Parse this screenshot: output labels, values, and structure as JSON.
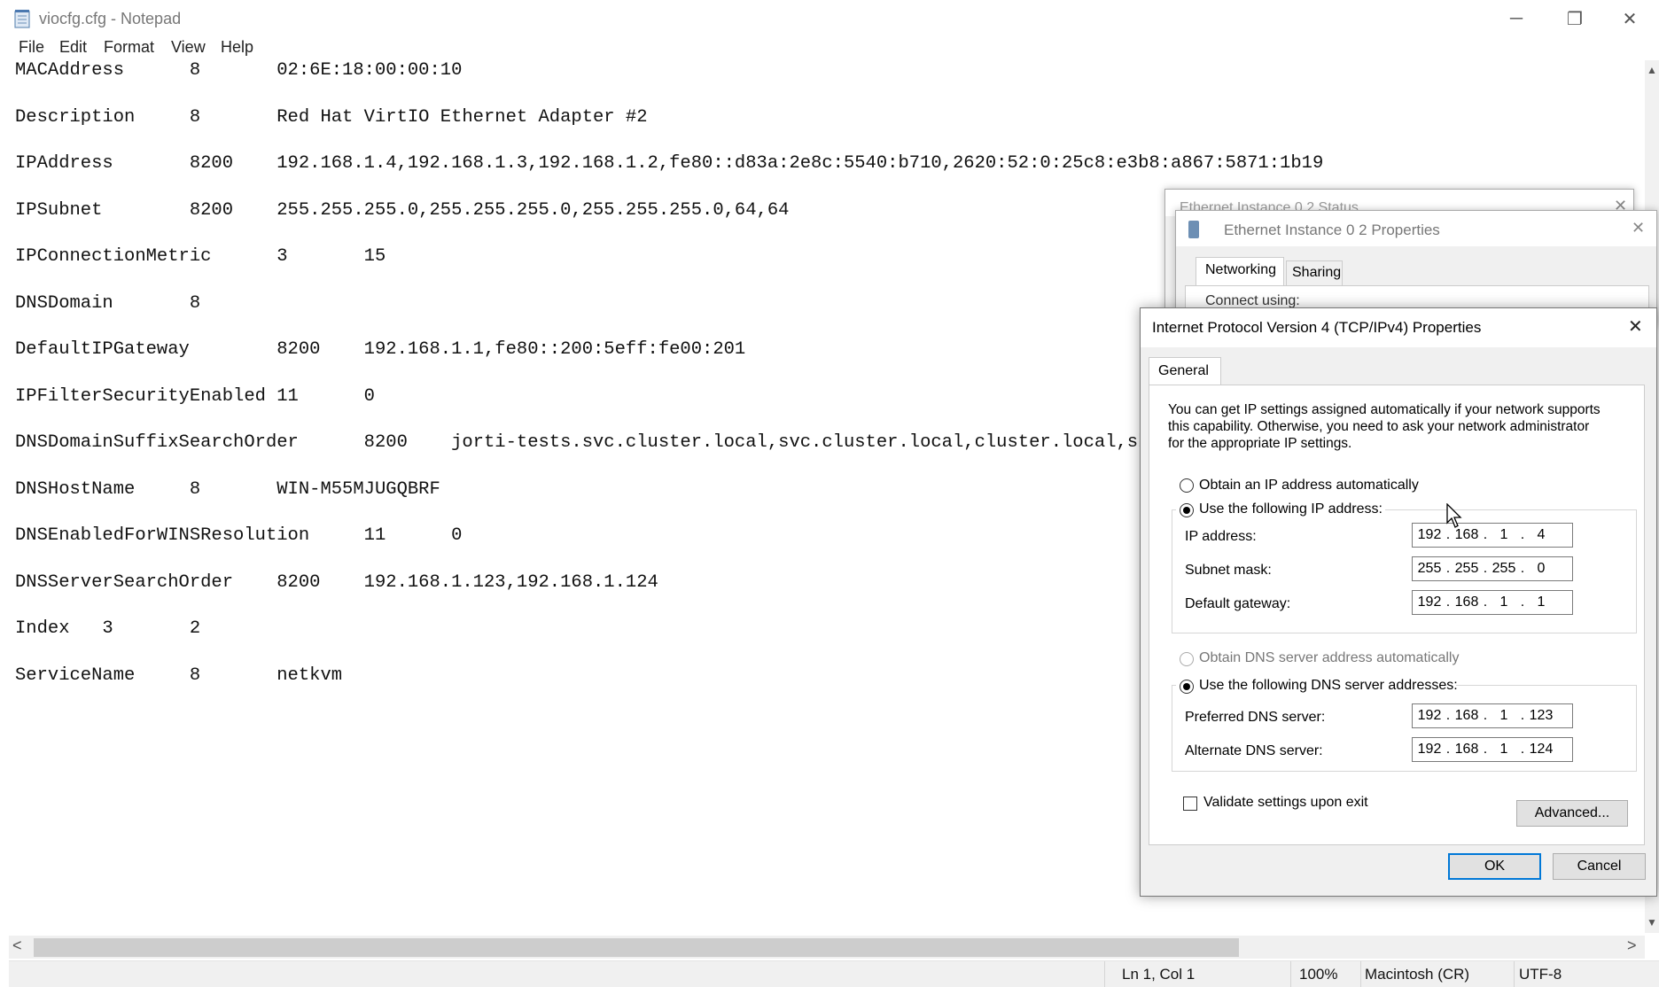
{
  "window": {
    "title": "viocfg.cfg - Notepad",
    "minimize": "─",
    "maximize": "❐",
    "close": "✕"
  },
  "menu": [
    "File",
    "Edit",
    "Format",
    "View",
    "Help"
  ],
  "lines": [
    "MACAddress      8       02:6E:18:00:00:10",
    "Description     8       Red Hat VirtIO Ethernet Adapter #2",
    "IPAddress       8200    192.168.1.4,192.168.1.3,192.168.1.2,fe80::d83a:2e8c:5540:b710,2620:52:0:25c8:e3b8:a867:5871:1b19",
    "IPSubnet        8200    255.255.255.0,255.255.255.0,255.255.255.0,64,64",
    "IPConnectionMetric      3       15",
    "DNSDomain       8",
    "DefaultIPGateway        8200    192.168.1.1,fe80::200:5eff:fe00:201",
    "IPFilterSecurityEnabled 11      0",
    "DNSDomainSuffixSearchOrder      8200    jorti-tests.svc.cluster.local,svc.cluster.local,cluster.local,sbr-virt",
    "DNSHostName     8       WIN-M55MJUGQBRF",
    "DNSEnabledForWINSResolution     11      0",
    "DNSServerSearchOrder    8200    192.168.1.123,192.168.1.124",
    "Index   3       2",
    "ServiceName     8       netkvm"
  ],
  "status": {
    "position": "Ln 1, Col 1",
    "zoom": "100%",
    "line_ending": "Macintosh (CR)",
    "encoding": "UTF-8"
  },
  "status_dialog": {
    "title": "Ethernet Instance 0 2 Status"
  },
  "properties_dialog": {
    "title": "Ethernet Instance 0 2 Properties",
    "tabs": [
      "Networking",
      "Sharing"
    ],
    "connect_using": "Connect using:"
  },
  "ipv4_dialog": {
    "title": "Internet Protocol Version 4 (TCP/IPv4) Properties",
    "tab": "General",
    "description": [
      "You can get IP settings assigned automatically if your network supports",
      "this capability. Otherwise, you need to ask your network administrator",
      "for the appropriate IP settings."
    ],
    "obtain_ip_auto": "Obtain an IP address automatically",
    "use_following_ip": "Use the following IP address:",
    "ip_address_label": "IP address:",
    "ip_address": [
      "192",
      "168",
      "1",
      "4"
    ],
    "subnet_mask_label": "Subnet mask:",
    "subnet_mask": [
      "255",
      "255",
      "255",
      "0"
    ],
    "gateway_label": "Default gateway:",
    "gateway": [
      "192",
      "168",
      "1",
      "1"
    ],
    "obtain_dns_auto": "Obtain DNS server address automatically",
    "use_following_dns": "Use the following DNS server addresses:",
    "preferred_dns_label": "Preferred DNS server:",
    "preferred_dns": [
      "192",
      "168",
      "1",
      "123"
    ],
    "alternate_dns_label": "Alternate DNS server:",
    "alternate_dns": [
      "192",
      "168",
      "1",
      "124"
    ],
    "validate_label": "Validate settings upon exit",
    "advanced_button": "Advanced...",
    "ok_button": "OK",
    "cancel_button": "Cancel",
    "close": "✕"
  }
}
